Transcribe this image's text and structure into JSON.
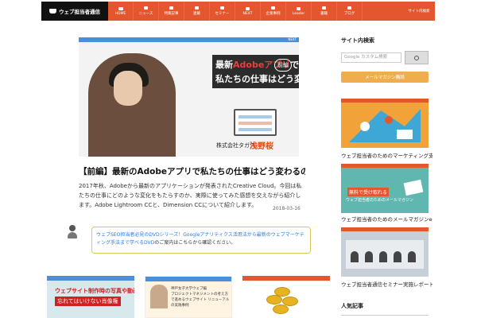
{
  "site": {
    "logo_text": "ウェブ担当者通信"
  },
  "nav": {
    "items": [
      {
        "label": "HOME"
      },
      {
        "label": "ニュース"
      },
      {
        "label": "特集記事"
      },
      {
        "label": "連載"
      },
      {
        "label": "セミナー"
      },
      {
        "label": "NEXT"
      },
      {
        "label": "企業事例"
      },
      {
        "label": "Leader"
      },
      {
        "label": "書籍"
      },
      {
        "label": "ブログ"
      }
    ],
    "search_label": "サイト内検索"
  },
  "hero": {
    "badge": "NEXT",
    "title_prefix": "最新",
    "title_highlight": "Adobeアプリ",
    "title_suffix": "で",
    "title_line2": "私たちの仕事はどう変わるのか？",
    "pill": "前編",
    "company": "株式会社タガス",
    "author": "浅野桜"
  },
  "article": {
    "title": "【前編】最新のAdobeアプリで私たちの仕事はどう変わるのか？",
    "body": "2017年秋、Adobeから最新のアプリケーションが発表されたCreative Cloud。今回は私たちの仕事にどのような変化をもたらすのか、実際に使ってみた感想を交えながら紹介します。Adobe Lightroom CCと、Dimension CCについて紹介します。",
    "date": "2018-03-16"
  },
  "notice": {
    "part1": "ウェブSEO担当者必見のDVDシリーズ！",
    "part2": "Googleアナリティクス活用法から最新のウェブマーケティング手法まで学べる",
    "part3": "DVD",
    "part4": "のご案内はこちらから確認ください。"
  },
  "cards": [
    {
      "line1": "ウェブサイト制作時の写真や動画撮影で",
      "line2": "忘れてはいけない肖像権"
    },
    {
      "header": "神戸女子大学ウェブ編",
      "text": "プロジェクトマネジメントの考え方で進めるウェブサイト リニューアルの実践事例"
    },
    {
      "label": ""
    }
  ],
  "sidebar": {
    "search_heading": "サイト内検索",
    "search_placeholder": "Google カスタム検索",
    "subscribe_label": "メールマガジン購読",
    "captions": [
      "ウェブ担当者のためのマーケティング支援",
      "ウェブ担当者のためのメールマガジンe通信",
      "ウェブ担当者通信セミナー実施レポート"
    ],
    "promo_line1": "無料で受け取れる",
    "promo_line2": "ウェブ担当者のためのメールマガジン",
    "bottom_heading": "人気記事"
  }
}
